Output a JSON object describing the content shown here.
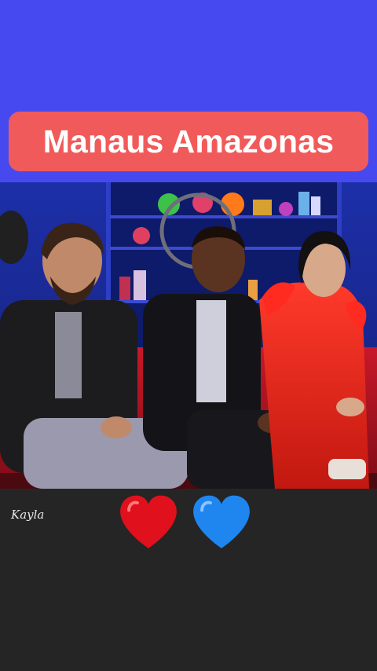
{
  "banner": {
    "title": "Manaus Amazonas"
  },
  "video": {
    "description_icon": "tv-studio-scene"
  },
  "footer": {
    "watermark": "Kayla",
    "hearts": [
      {
        "icon": "red-heart-icon",
        "color": "#e0101c"
      },
      {
        "icon": "blue-heart-icon",
        "color": "#1f86f0"
      }
    ]
  },
  "colors": {
    "top_background": "#4649f0",
    "banner_background": "#f15a5a",
    "bottom_background": "#252526",
    "banner_text": "#ffffff"
  }
}
